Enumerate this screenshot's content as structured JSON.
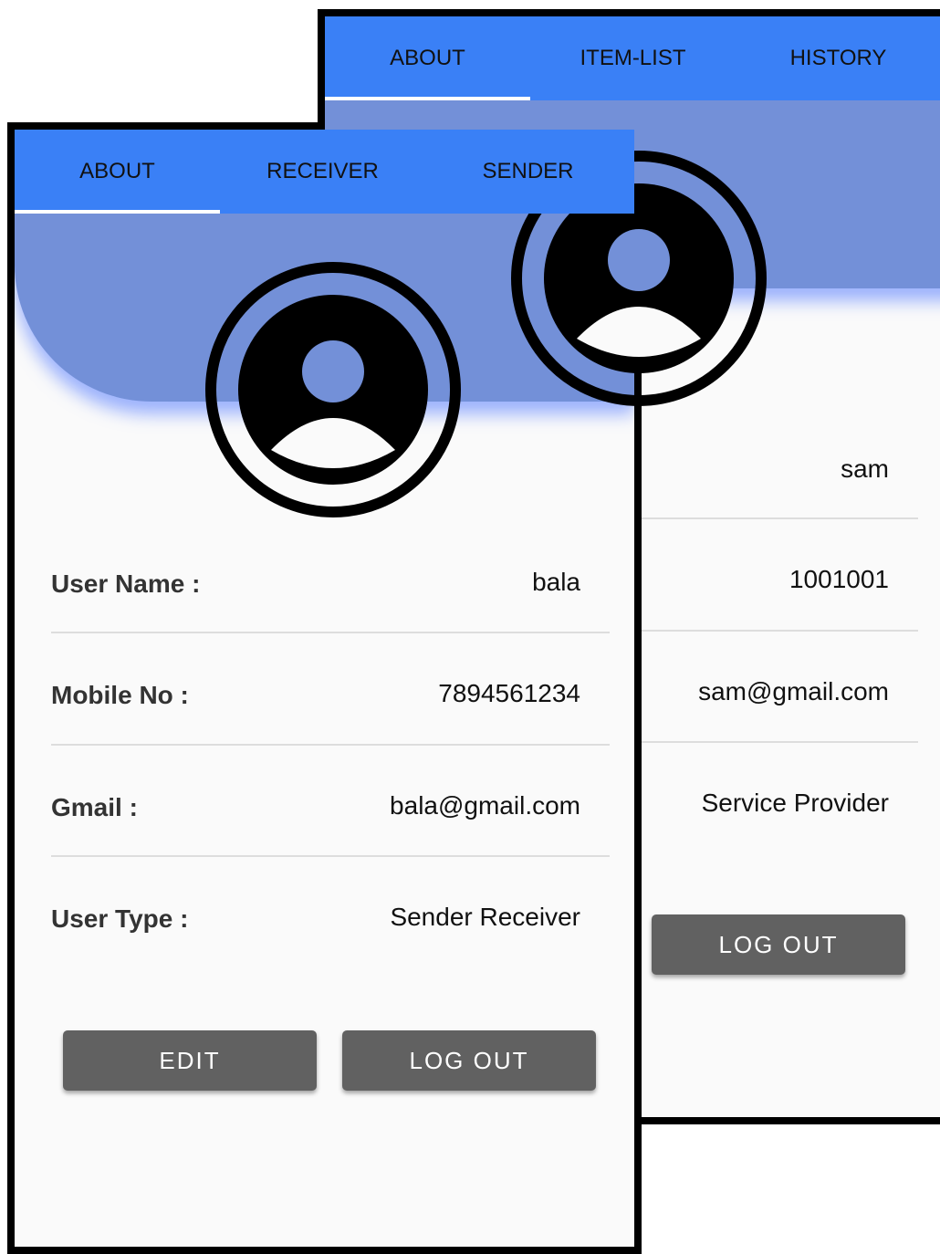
{
  "back_screen": {
    "tabs": [
      {
        "label": "ABOUT",
        "active": true
      },
      {
        "label": "ITEM-LIST",
        "active": false
      },
      {
        "label": "HISTORY",
        "active": false
      }
    ],
    "fields": [
      {
        "value": "sam"
      },
      {
        "value": "1001001"
      },
      {
        "value": "sam@gmail.com"
      },
      {
        "value": "Service Provider"
      }
    ],
    "logout_label": "LOG OUT"
  },
  "front_screen": {
    "tabs": [
      {
        "label": "ABOUT",
        "active": true
      },
      {
        "label": "RECEIVER",
        "active": false
      },
      {
        "label": "SENDER",
        "active": false
      }
    ],
    "fields": [
      {
        "label": "User Name :",
        "value": "bala"
      },
      {
        "label": "Mobile No :",
        "value": "7894561234"
      },
      {
        "label": "Gmail :",
        "value": "bala@gmail.com"
      },
      {
        "label": "User Type :",
        "value": "Sender Receiver"
      }
    ],
    "edit_label": "EDIT",
    "logout_label": "LOG OUT"
  },
  "colors": {
    "tab_bar": "#3a80f6",
    "header_curve": "#7390d8",
    "button": "#616161",
    "background": "#fafafa"
  },
  "icons": {
    "avatar": "account-circle-icon"
  }
}
